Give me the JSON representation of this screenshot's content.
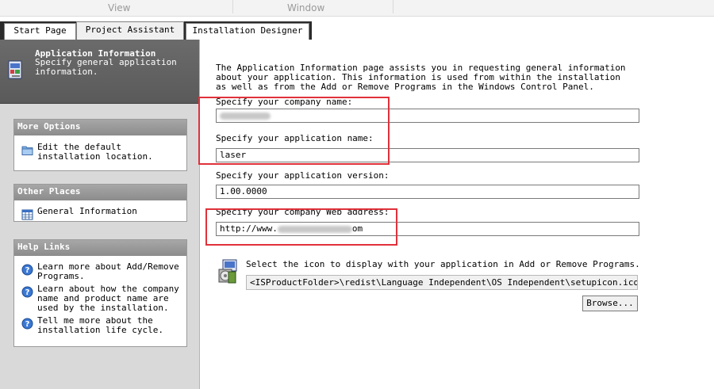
{
  "ribbon": {
    "view_label": "View",
    "window_label": "Window"
  },
  "tabs": [
    {
      "label": "Start Page",
      "active": false
    },
    {
      "label": "Project Assistant",
      "active": true
    },
    {
      "label": "Installation Designer",
      "active": false
    }
  ],
  "left_header": {
    "title": "Application Information",
    "description": "Specify general application information."
  },
  "more_options": {
    "title": "More Options",
    "items": [
      {
        "label": "Edit the default installation location.",
        "icon": "folder-icon"
      }
    ]
  },
  "other_places": {
    "title": "Other Places",
    "items": [
      {
        "label": "General Information",
        "icon": "calendar-grid-icon"
      }
    ]
  },
  "help_links": {
    "title": "Help Links",
    "items": [
      {
        "label": "Learn more about Add/Remove Programs.",
        "icon": "help-icon"
      },
      {
        "label": "Learn about how the company name and product name are used by the installation.",
        "icon": "help-icon"
      },
      {
        "label": "Tell me more about the installation life cycle.",
        "icon": "help-icon"
      }
    ]
  },
  "main": {
    "intro": "The Application Information page assists you in requesting general information about your application. This information is used from within the installation as well as from the Add or Remove Programs in the Windows Control Panel.",
    "company_name": {
      "label": "Specify your company name:",
      "value": ""
    },
    "app_name": {
      "label": "Specify your application name:",
      "value": "laser"
    },
    "app_version": {
      "label": "Specify your application version:",
      "value": "1.00.0000"
    },
    "web_address": {
      "label": "Specify your company Web address:",
      "value_prefix": "http://www.",
      "value_suffix": "om"
    },
    "icon_select": {
      "label": "Select the icon to display with your application in Add or Remove Programs.",
      "path": "<ISProductFolder>\\redist\\Language Independent\\OS Independent\\setupicon.ico",
      "browse_label": "Browse..."
    }
  },
  "colors": {
    "highlight_box": "#e0313a",
    "panel_title_bg": "#9a9a9a",
    "left_header_bg": "#606060"
  }
}
